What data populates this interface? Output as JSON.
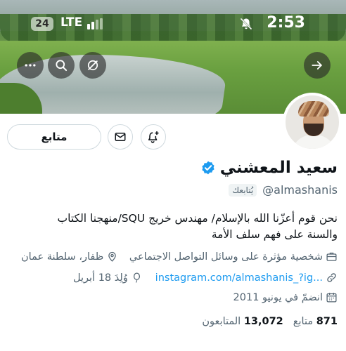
{
  "status_bar": {
    "battery": "24",
    "network": "LTE",
    "time": "2:53"
  },
  "nav": {
    "more_icon": "more-horizontal-icon",
    "search_icon": "search-icon",
    "grok_icon": "grok-icon",
    "back_icon": "arrow-right-icon"
  },
  "actions": {
    "follow_label": "متابع",
    "message_icon": "envelope-icon",
    "notify_icon": "bell-plus-icon"
  },
  "profile": {
    "name": "سعيد المعشني",
    "handle": "@almashanis",
    "follows_you": "يُتابعك",
    "bio_line1": "نحن قوم أعزّنا الله بالإسلام/ مهندس خريج SQU/منهجنا الكتاب",
    "bio_line2": "والسنة على فهم سلف الأمة",
    "category": "شخصية مؤثرة على وسائل التواصل الاجتماعي",
    "location": "ظفار، سلطنة عمان",
    "link": "instagram.com/almashanis_?ig...",
    "birthday": "وُلِدَ 18 أبريل",
    "joined": "انضمّ في يونيو 2011"
  },
  "stats": {
    "following_count": "871",
    "following_label": "متابع",
    "followers_count": "13,072",
    "followers_label": "المتابعون"
  },
  "colors": {
    "link": "#1d9bf0",
    "verified": "#1d9bf0",
    "secondary_text": "#536471"
  }
}
